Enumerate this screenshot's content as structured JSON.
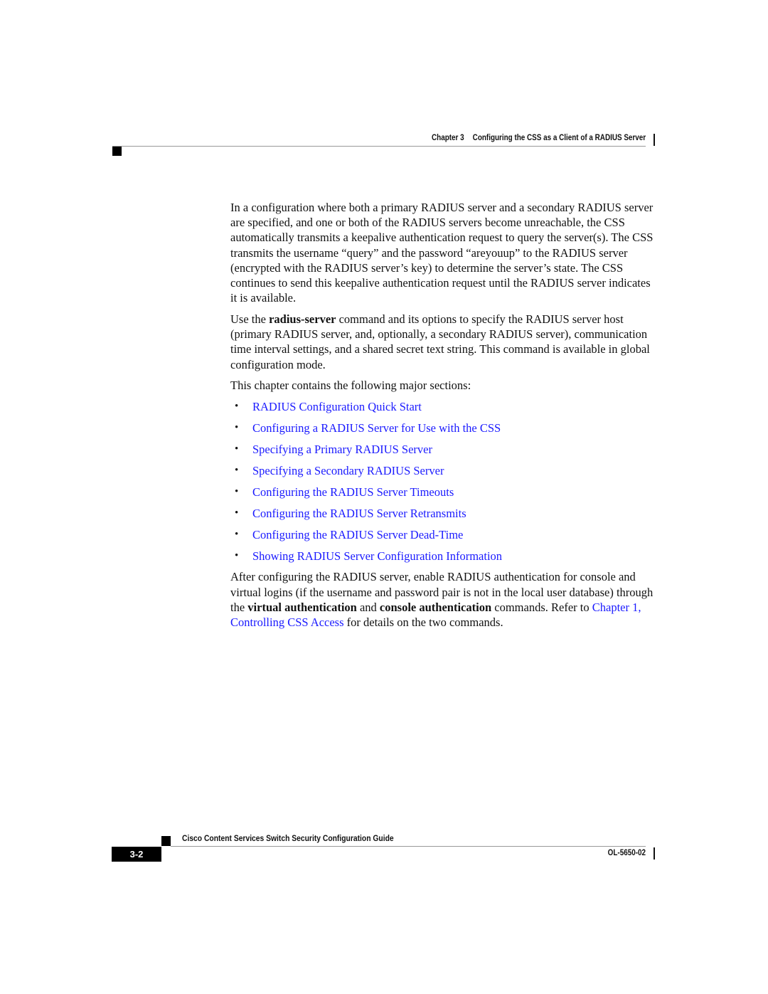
{
  "header": {
    "chapter_label": "Chapter 3",
    "chapter_title": "Configuring the CSS as a Client of a RADIUS Server"
  },
  "body": {
    "para1": "In a configuration where both a primary RADIUS server and a secondary RADIUS server are specified, and one or both of the RADIUS servers become unreachable, the CSS automatically transmits a keepalive authentication request to query the server(s). The CSS transmits the username “query” and the password “areyouup” to the RADIUS server (encrypted with the RADIUS server’s key) to determine the server’s state. The CSS continues to send this keepalive authentication request until the RADIUS server indicates it is available.",
    "para2": {
      "pre": "Use the ",
      "bold": "radius-server",
      "post": " command and its options to specify the RADIUS server host (primary RADIUS server, and, optionally, a secondary RADIUS server), communication time interval settings, and a shared secret text string. This command is available in global configuration mode."
    },
    "para3": "This chapter contains the following major sections:",
    "bullet_glyph": "•",
    "sections": [
      "RADIUS Configuration Quick Start",
      "Configuring a RADIUS Server for Use with the CSS",
      "Specifying a Primary RADIUS Server",
      "Specifying a Secondary RADIUS Server",
      "Configuring the RADIUS Server Timeouts",
      "Configuring the RADIUS Server Retransmits",
      "Configuring the RADIUS Server Dead-Time",
      "Showing RADIUS Server Configuration Information"
    ],
    "para4": {
      "t1": "After configuring the RADIUS server, enable RADIUS authentication for console and virtual logins (if the username and password pair is not in the local user database) through the ",
      "b1": "virtual authentication",
      "t2": " and ",
      "b2": "console authentication",
      "t3": " commands. Refer to ",
      "link": "Chapter 1, Controlling CSS Access",
      "t4": " for details on the two commands."
    }
  },
  "footer": {
    "guide_title": "Cisco Content Services Switch Security Configuration Guide",
    "page_number": "3-2",
    "doc_number": "OL-5650-02"
  },
  "colors": {
    "link": "#1a1aff",
    "text": "#111111"
  }
}
